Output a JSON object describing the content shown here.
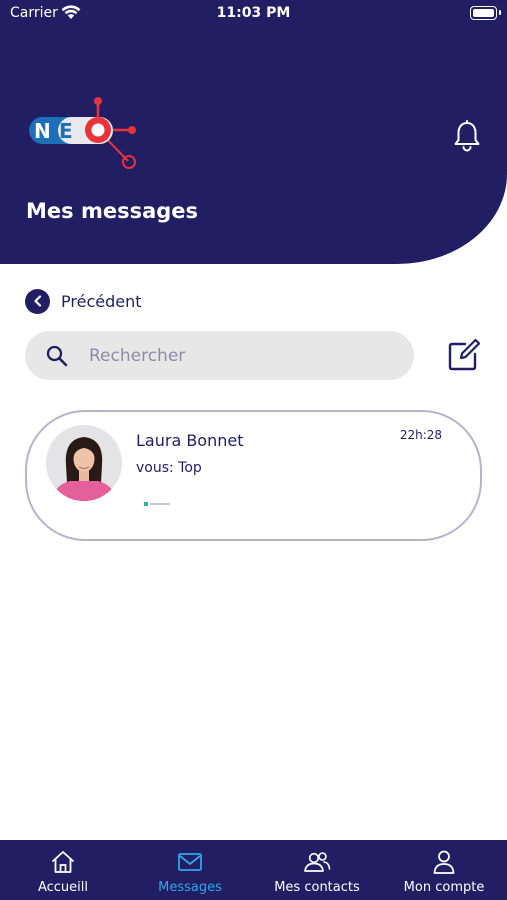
{
  "status_bar": {
    "carrier": "Carrier",
    "time": "11:03 PM"
  },
  "header": {
    "title": "Mes messages",
    "logo_icon": "neo-logo",
    "bell_icon": "bell-icon"
  },
  "back": {
    "label": "Précédent"
  },
  "search": {
    "placeholder": "Rechercher",
    "value": ""
  },
  "conversations": [
    {
      "name": "Laura Bonnet",
      "preview": "vous: Top",
      "time": "22h:28"
    }
  ],
  "tabs": [
    {
      "label": "Accueill",
      "icon": "home-icon",
      "active": false
    },
    {
      "label": "Messages",
      "icon": "envelope-icon",
      "active": true
    },
    {
      "label": "Mes contacts",
      "icon": "users-icon",
      "active": false
    },
    {
      "label": "Mon compte",
      "icon": "user-icon",
      "active": false
    }
  ],
  "colors": {
    "primary": "#221e63",
    "accent_active": "#2ea8e6",
    "logo_red": "#e8333a",
    "logo_blue": "#1d6fb8",
    "search_bg": "#e7e7e7",
    "card_border": "#b7b3cc"
  }
}
